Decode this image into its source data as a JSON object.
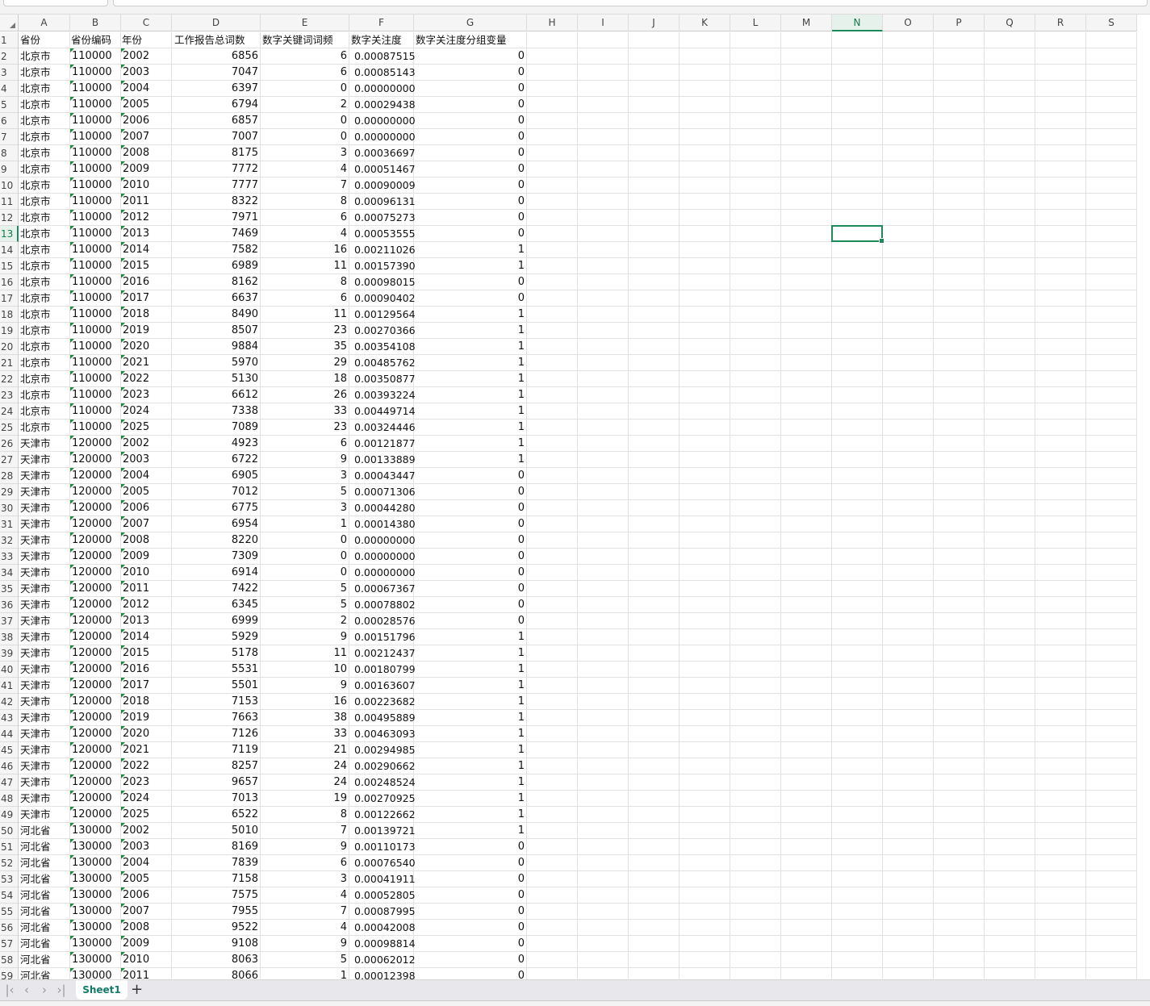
{
  "columns": [
    "A",
    "B",
    "C",
    "D",
    "E",
    "F",
    "G",
    "H",
    "I",
    "J",
    "K",
    "L",
    "M",
    "N",
    "O",
    "P",
    "Q",
    "R",
    "S"
  ],
  "active_cell": "N13",
  "accent_color": "#1e8a5a",
  "header_row": [
    "省份",
    "省份编码",
    "年份",
    "工作报告总词数",
    "数字关键词词频",
    "数字关注度",
    "数字关注度分组变量"
  ],
  "rows": [
    [
      "北京市",
      "110000",
      "2002",
      "6856",
      "6",
      "0.00087515",
      "0"
    ],
    [
      "北京市",
      "110000",
      "2003",
      "7047",
      "6",
      "0.00085143",
      "0"
    ],
    [
      "北京市",
      "110000",
      "2004",
      "6397",
      "0",
      "0.00000000",
      "0"
    ],
    [
      "北京市",
      "110000",
      "2005",
      "6794",
      "2",
      "0.00029438",
      "0"
    ],
    [
      "北京市",
      "110000",
      "2006",
      "6857",
      "0",
      "0.00000000",
      "0"
    ],
    [
      "北京市",
      "110000",
      "2007",
      "7007",
      "0",
      "0.00000000",
      "0"
    ],
    [
      "北京市",
      "110000",
      "2008",
      "8175",
      "3",
      "0.00036697",
      "0"
    ],
    [
      "北京市",
      "110000",
      "2009",
      "7772",
      "4",
      "0.00051467",
      "0"
    ],
    [
      "北京市",
      "110000",
      "2010",
      "7777",
      "7",
      "0.00090009",
      "0"
    ],
    [
      "北京市",
      "110000",
      "2011",
      "8322",
      "8",
      "0.00096131",
      "0"
    ],
    [
      "北京市",
      "110000",
      "2012",
      "7971",
      "6",
      "0.00075273",
      "0"
    ],
    [
      "北京市",
      "110000",
      "2013",
      "7469",
      "4",
      "0.00053555",
      "0"
    ],
    [
      "北京市",
      "110000",
      "2014",
      "7582",
      "16",
      "0.00211026",
      "1"
    ],
    [
      "北京市",
      "110000",
      "2015",
      "6989",
      "11",
      "0.00157390",
      "1"
    ],
    [
      "北京市",
      "110000",
      "2016",
      "8162",
      "8",
      "0.00098015",
      "0"
    ],
    [
      "北京市",
      "110000",
      "2017",
      "6637",
      "6",
      "0.00090402",
      "0"
    ],
    [
      "北京市",
      "110000",
      "2018",
      "8490",
      "11",
      "0.00129564",
      "1"
    ],
    [
      "北京市",
      "110000",
      "2019",
      "8507",
      "23",
      "0.00270366",
      "1"
    ],
    [
      "北京市",
      "110000",
      "2020",
      "9884",
      "35",
      "0.00354108",
      "1"
    ],
    [
      "北京市",
      "110000",
      "2021",
      "5970",
      "29",
      "0.00485762",
      "1"
    ],
    [
      "北京市",
      "110000",
      "2022",
      "5130",
      "18",
      "0.00350877",
      "1"
    ],
    [
      "北京市",
      "110000",
      "2023",
      "6612",
      "26",
      "0.00393224",
      "1"
    ],
    [
      "北京市",
      "110000",
      "2024",
      "7338",
      "33",
      "0.00449714",
      "1"
    ],
    [
      "北京市",
      "110000",
      "2025",
      "7089",
      "23",
      "0.00324446",
      "1"
    ],
    [
      "天津市",
      "120000",
      "2002",
      "4923",
      "6",
      "0.00121877",
      "1"
    ],
    [
      "天津市",
      "120000",
      "2003",
      "6722",
      "9",
      "0.00133889",
      "1"
    ],
    [
      "天津市",
      "120000",
      "2004",
      "6905",
      "3",
      "0.00043447",
      "0"
    ],
    [
      "天津市",
      "120000",
      "2005",
      "7012",
      "5",
      "0.00071306",
      "0"
    ],
    [
      "天津市",
      "120000",
      "2006",
      "6775",
      "3",
      "0.00044280",
      "0"
    ],
    [
      "天津市",
      "120000",
      "2007",
      "6954",
      "1",
      "0.00014380",
      "0"
    ],
    [
      "天津市",
      "120000",
      "2008",
      "8220",
      "0",
      "0.00000000",
      "0"
    ],
    [
      "天津市",
      "120000",
      "2009",
      "7309",
      "0",
      "0.00000000",
      "0"
    ],
    [
      "天津市",
      "120000",
      "2010",
      "6914",
      "0",
      "0.00000000",
      "0"
    ],
    [
      "天津市",
      "120000",
      "2011",
      "7422",
      "5",
      "0.00067367",
      "0"
    ],
    [
      "天津市",
      "120000",
      "2012",
      "6345",
      "5",
      "0.00078802",
      "0"
    ],
    [
      "天津市",
      "120000",
      "2013",
      "6999",
      "2",
      "0.00028576",
      "0"
    ],
    [
      "天津市",
      "120000",
      "2014",
      "5929",
      "9",
      "0.00151796",
      "1"
    ],
    [
      "天津市",
      "120000",
      "2015",
      "5178",
      "11",
      "0.00212437",
      "1"
    ],
    [
      "天津市",
      "120000",
      "2016",
      "5531",
      "10",
      "0.00180799",
      "1"
    ],
    [
      "天津市",
      "120000",
      "2017",
      "5501",
      "9",
      "0.00163607",
      "1"
    ],
    [
      "天津市",
      "120000",
      "2018",
      "7153",
      "16",
      "0.00223682",
      "1"
    ],
    [
      "天津市",
      "120000",
      "2019",
      "7663",
      "38",
      "0.00495889",
      "1"
    ],
    [
      "天津市",
      "120000",
      "2020",
      "7126",
      "33",
      "0.00463093",
      "1"
    ],
    [
      "天津市",
      "120000",
      "2021",
      "7119",
      "21",
      "0.00294985",
      "1"
    ],
    [
      "天津市",
      "120000",
      "2022",
      "8257",
      "24",
      "0.00290662",
      "1"
    ],
    [
      "天津市",
      "120000",
      "2023",
      "9657",
      "24",
      "0.00248524",
      "1"
    ],
    [
      "天津市",
      "120000",
      "2024",
      "7013",
      "19",
      "0.00270925",
      "1"
    ],
    [
      "天津市",
      "120000",
      "2025",
      "6522",
      "8",
      "0.00122662",
      "1"
    ],
    [
      "河北省",
      "130000",
      "2002",
      "5010",
      "7",
      "0.00139721",
      "1"
    ],
    [
      "河北省",
      "130000",
      "2003",
      "8169",
      "9",
      "0.00110173",
      "0"
    ],
    [
      "河北省",
      "130000",
      "2004",
      "7839",
      "6",
      "0.00076540",
      "0"
    ],
    [
      "河北省",
      "130000",
      "2005",
      "7158",
      "3",
      "0.00041911",
      "0"
    ],
    [
      "河北省",
      "130000",
      "2006",
      "7575",
      "4",
      "0.00052805",
      "0"
    ],
    [
      "河北省",
      "130000",
      "2007",
      "7955",
      "7",
      "0.00087995",
      "0"
    ],
    [
      "河北省",
      "130000",
      "2008",
      "9522",
      "4",
      "0.00042008",
      "0"
    ],
    [
      "河北省",
      "130000",
      "2009",
      "9108",
      "9",
      "0.00098814",
      "0"
    ],
    [
      "河北省",
      "130000",
      "2010",
      "8063",
      "5",
      "0.00062012",
      "0"
    ],
    [
      "河北省",
      "130000",
      "2011",
      "8066",
      "1",
      "0.00012398",
      "0"
    ]
  ],
  "sheet_tabs": [
    {
      "label": "Sheet1",
      "active": true
    }
  ],
  "add_sheet_label": "+",
  "nav_icons": [
    "first-sheet-icon",
    "prev-sheet-icon",
    "next-sheet-icon",
    "last-sheet-icon"
  ]
}
